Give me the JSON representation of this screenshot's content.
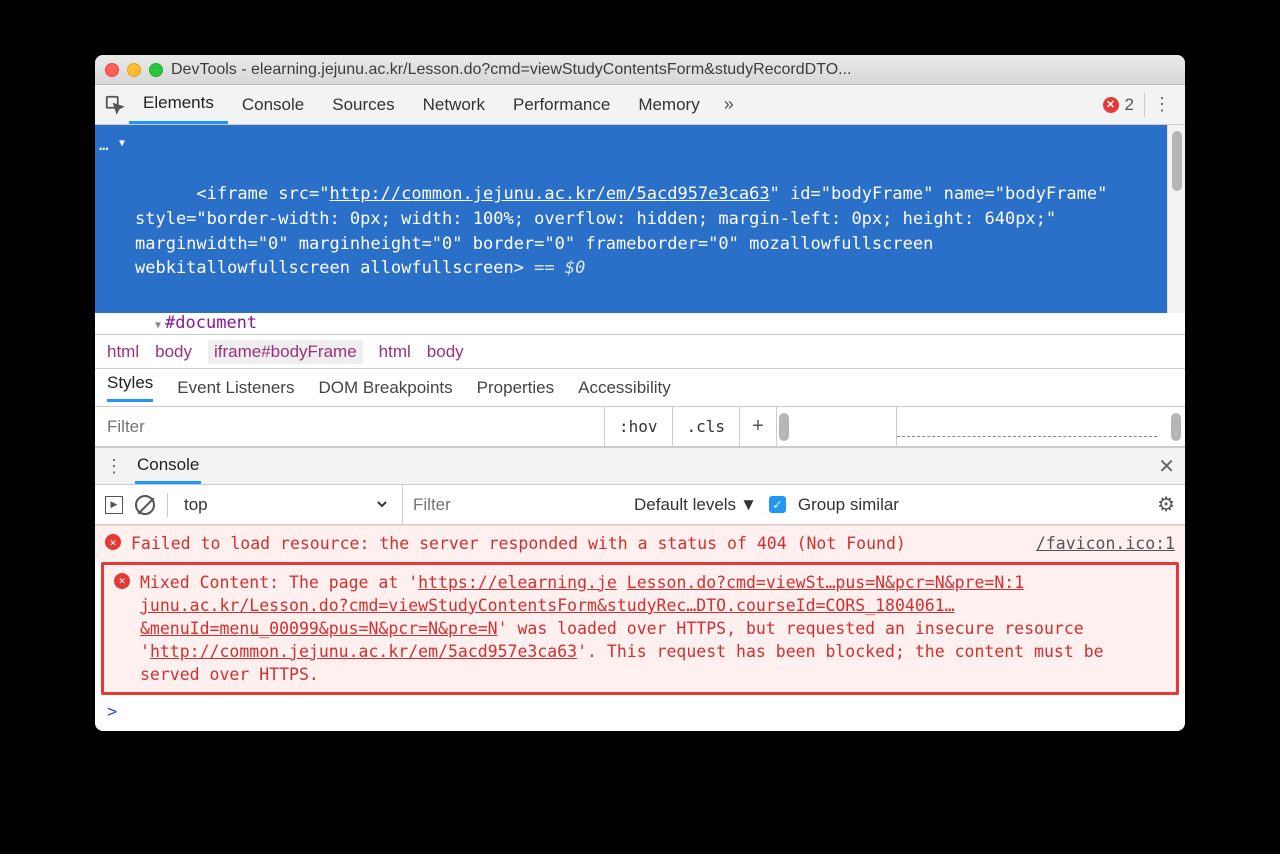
{
  "window": {
    "title": "DevTools - elearning.jejunu.ac.kr/Lesson.do?cmd=viewStudyContentsForm&studyRecordDTO..."
  },
  "mainTabs": {
    "items": [
      "Elements",
      "Console",
      "Sources",
      "Network",
      "Performance",
      "Memory"
    ],
    "more": "»",
    "activeIndex": 0,
    "errorCount": "2"
  },
  "elements": {
    "codePrefix": "<iframe src=\"",
    "codeUrl": "http://common.jejunu.ac.kr/em/5acd957e3ca63",
    "codeMid": "\" id=\"bodyFrame\" name=\"bodyFrame\" style=\"border-width: 0px; width: 100%; overflow: hidden; margin-left: 0px; height: 640px;\" marginwidth=\"0\" marginheight=\"0\" border=\"0\" frameborder=\"0\" mozallowfullscreen webkitallowfullscreen allowfullscreen>",
    "codeRest": " == $0",
    "childNode": "#document"
  },
  "breadcrumb": [
    "html",
    "body",
    "iframe#bodyFrame",
    "html",
    "body"
  ],
  "subTabs": [
    "Styles",
    "Event Listeners",
    "DOM Breakpoints",
    "Properties",
    "Accessibility"
  ],
  "stylesFilter": {
    "placeholder": "Filter",
    "hov": ":hov",
    "cls": ".cls"
  },
  "drawer": {
    "tab": "Console"
  },
  "consoleToolbar": {
    "context": "top",
    "filterPlaceholder": "Filter",
    "levels": "Default levels",
    "group": "Group similar"
  },
  "consoleMessages": {
    "m1_text": "Failed to load resource: the server responded with a status of 404 (Not Found)",
    "m1_link": "/favicon.ico:1",
    "m2_lead": "Mixed Content: The page at '",
    "m2_u1": "https://elearning.je",
    "m2_gap": " ",
    "m2_u1b": "Lesson.do?cmd=viewSt…pus=N&pcr=N&pre=N:1",
    "m2_u2": "junu.ac.kr/Lesson.do?cmd=viewStudyContentsForm&studyRec…DTO.courseId=CORS_1804061…&menuId=menu_00099&pus=N&pcr=N&pre=N",
    "m2_mid": "' was loaded over HTTPS, but requested an insecure resource '",
    "m2_u3": "http://common.jejunu.ac.kr/em/5acd957e3ca63",
    "m2_tail": "'. This request has been blocked; the content must be served over HTTPS."
  },
  "prompt": ">"
}
